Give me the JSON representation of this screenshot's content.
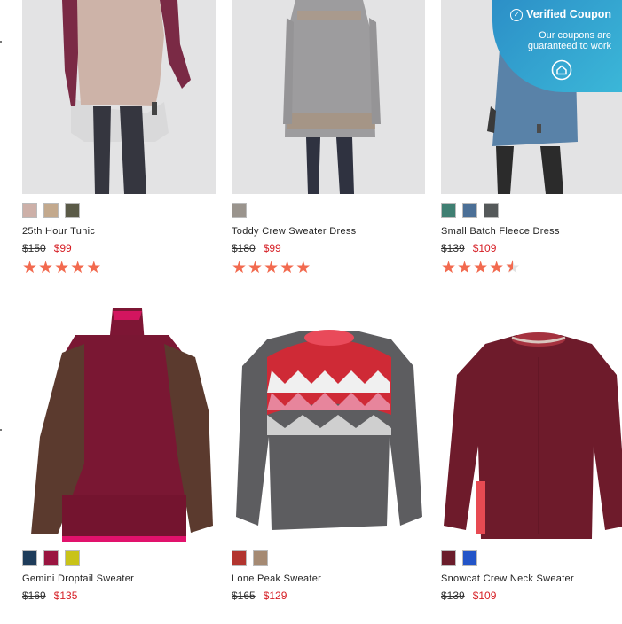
{
  "coupon": {
    "title": "Verified Coupon",
    "subtitle_line1": "Our coupons are",
    "subtitle_line2": "guaranteed to work"
  },
  "products": [
    {
      "name": "25th Hour Tunic",
      "was": "$150",
      "now": "$99",
      "rating": 5,
      "swatches": [
        "#cdb0a8",
        "#c3a98d",
        "#5a5a47"
      ]
    },
    {
      "name": "Toddy Crew Sweater Dress",
      "was": "$180",
      "now": "$99",
      "rating": 5,
      "swatches": [
        "#9a948d"
      ]
    },
    {
      "name": "Small Batch Fleece Dress",
      "was": "$139",
      "now": "$109",
      "rating": 4.5,
      "swatches": [
        "#3f7f72",
        "#4b6f96",
        "#55595a"
      ]
    },
    {
      "name": "Gemini Droptail Sweater",
      "was": "$169",
      "now": "$135",
      "swatches": [
        "#1e3c5a",
        "#9a1540",
        "#c9c318"
      ]
    },
    {
      "name": "Lone Peak Sweater",
      "was": "$165",
      "now": "$129",
      "swatches": [
        "#b2352f",
        "#a58a73"
      ]
    },
    {
      "name": "Snowcat Crew Neck Sweater",
      "was": "$139",
      "now": "$109",
      "swatches": [
        "#6b1d2b",
        "#2355c8"
      ]
    }
  ],
  "colors": {
    "star": "#f26a4f",
    "sale_price": "#d61f26",
    "coupon_bg": "#2c8fc7"
  }
}
